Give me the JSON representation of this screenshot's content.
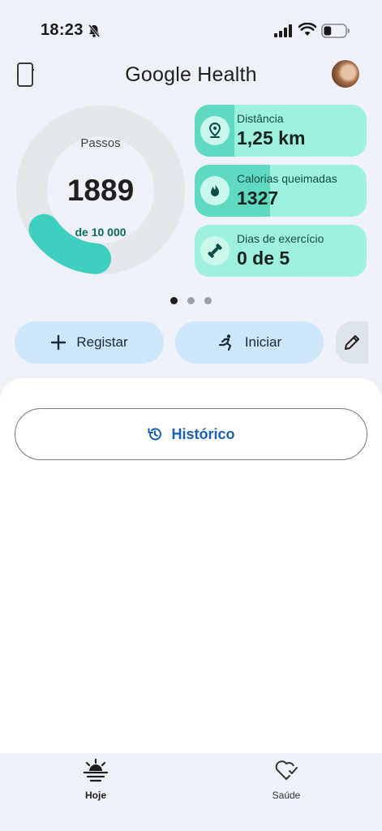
{
  "status_bar": {
    "time": "18:23",
    "battery_level": 0.35
  },
  "header": {
    "title": "Google Health"
  },
  "steps": {
    "label": "Passos",
    "value": "1889",
    "goal_label": "de 10 000",
    "progress": 0.1889,
    "colors": {
      "track": "#e3e6ea",
      "progress": "#3fcfbf"
    }
  },
  "stats": [
    {
      "label": "Distância",
      "value": "1,25 km",
      "icon": "location-pin-icon",
      "fill": 0.23
    },
    {
      "label": "Calorias queimadas",
      "value": "1327",
      "icon": "flame-icon",
      "fill": 0.44
    },
    {
      "label": "Dias de exercício",
      "value": "0 de 5",
      "icon": "dumbbell-icon",
      "fill": 0.0
    }
  ],
  "pager": {
    "count": 3,
    "active": 0
  },
  "actions": {
    "register_label": "Registar",
    "start_label": "Iniciar"
  },
  "history": {
    "label": "Histórico"
  },
  "bottom_nav": {
    "items": [
      {
        "label": "Hoje",
        "icon": "sunrise-icon",
        "active": true
      },
      {
        "label": "Saúde",
        "icon": "heart-check-icon",
        "active": false
      }
    ]
  },
  "colors": {
    "background": "#eef2f8",
    "accent_teal": "#3fcfbf",
    "card_bg": "#9ef0df",
    "pill_blue": "#cde6fb",
    "link_blue": "#1a5fb4"
  }
}
